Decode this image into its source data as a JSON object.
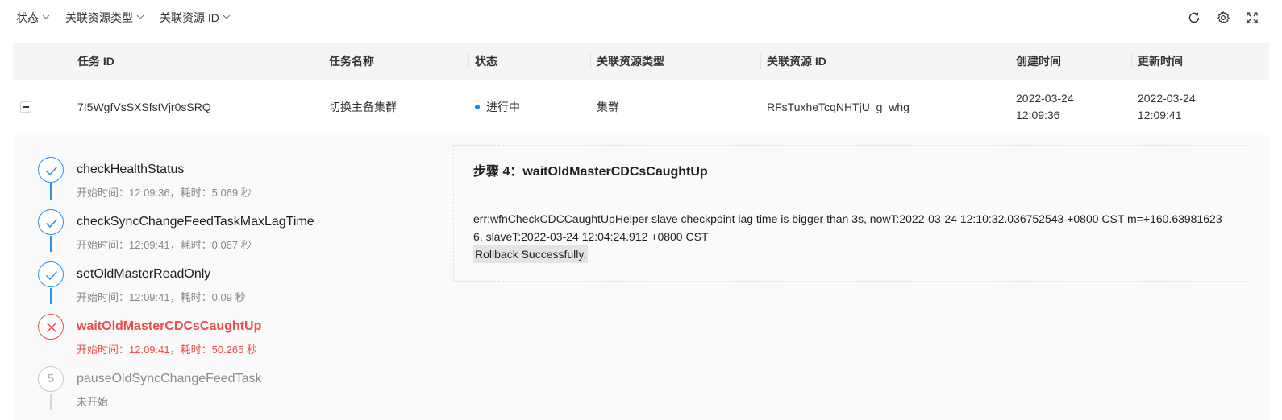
{
  "filters": [
    {
      "label": "状态"
    },
    {
      "label": "关联资源类型"
    },
    {
      "label": "关联资源 ID"
    }
  ],
  "toolbar_icons": [
    "refresh-icon",
    "settings-icon",
    "fullscreen-icon"
  ],
  "table": {
    "headers": {
      "task_id": "任务 ID",
      "task_name": "任务名称",
      "status": "状态",
      "resource_type": "关联资源类型",
      "resource_id": "关联资源 ID",
      "created": "创建时间",
      "updated": "更新时间"
    },
    "row": {
      "task_id": "7I5WgfVsSXSfstVjr0sSRQ",
      "task_name": "切换主备集群",
      "status": "进行中",
      "status_color": "#0d8cf0",
      "resource_type": "集群",
      "resource_id": "RFsTuxheTcqNHTjU_g_whg",
      "created_date": "2022-03-24",
      "created_time": "12:09:36",
      "updated_date": "2022-03-24",
      "updated_time": "12:09:41"
    }
  },
  "steps": [
    {
      "name": "checkHealthStatus",
      "meta": "开始时间：12:09:36，耗时：5.069 秒",
      "state": "done"
    },
    {
      "name": "checkSyncChangeFeedTaskMaxLagTime",
      "meta": "开始时间：12:09:41，耗时：0.067 秒",
      "state": "done"
    },
    {
      "name": "setOldMasterReadOnly",
      "meta": "开始时间：12:09:41，耗时：0.09 秒",
      "state": "done"
    },
    {
      "name": "waitOldMasterCDCsCaughtUp",
      "meta": "开始时间：12:09:41，耗时：50.265 秒",
      "state": "error"
    },
    {
      "name": "pauseOldSyncChangeFeedTask",
      "meta": "未开始",
      "state": "pending",
      "number": "5"
    }
  ],
  "detail": {
    "title": "步骤 4：waitOldMasterCDCsCaughtUp",
    "error_text": "err:wfnCheckCDCCaughtUpHelper slave checkpoint lag time is bigger than 3s, nowT:2022-03-24 12:10:32.036752543 +0800 CST m=+160.639816236, slaveT:2022-03-24 12:04:24.912 +0800 CST",
    "rollback_text": "Rollback Successfully."
  },
  "colors": {
    "accent": "#2a8ef5",
    "error": "#f04a4a",
    "pending": "#c8c8c8"
  }
}
